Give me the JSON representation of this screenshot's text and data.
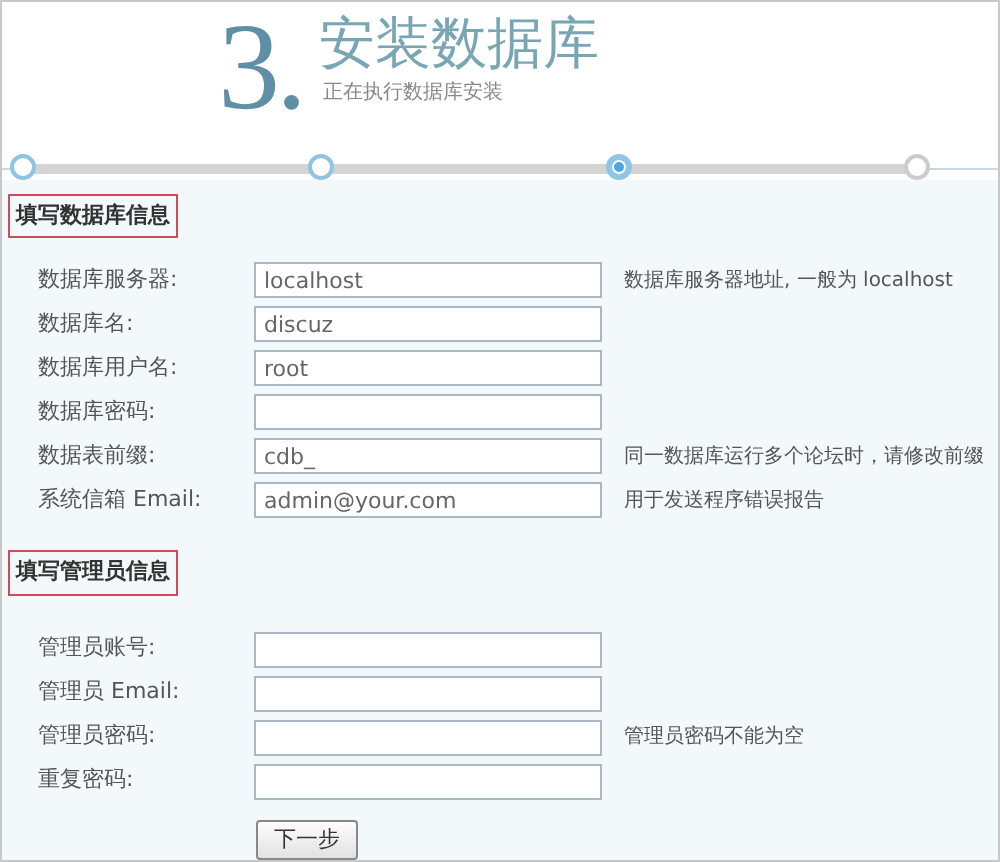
{
  "header": {
    "step_number": "3.",
    "title": "安装数据库",
    "subtitle": "正在执行数据库安装"
  },
  "steps": [
    {
      "selected": false
    },
    {
      "selected": false
    },
    {
      "selected": true
    },
    {
      "selected": false
    }
  ],
  "sections": [
    {
      "heading": "填写数据库信息",
      "fields": [
        {
          "label": "数据库服务器:",
          "value": "localhost",
          "hint": "数据库服务器地址, 一般为 localhost"
        },
        {
          "label": "数据库名:",
          "value": "discuz"
        },
        {
          "label": "数据库用户名:",
          "value": "root"
        },
        {
          "label": "数据库密码:"
        },
        {
          "label": "数据表前缀:",
          "value": "cdb_",
          "hint": "同一数据库运行多个论坛时，请修改前缀"
        },
        {
          "label": "系统信箱 Email:",
          "value": "admin@your.com",
          "hint": "用于发送程序错误报告"
        }
      ]
    },
    {
      "heading": "填写管理员信息",
      "fields": [
        {
          "label": "管理员账号:"
        },
        {
          "label": "管理员 Email:"
        },
        {
          "label": "管理员密码:",
          "hint": "管理员密码不能为空"
        },
        {
          "label": "重复密码:"
        }
      ]
    }
  ],
  "submit": {
    "label": "下一步"
  }
}
